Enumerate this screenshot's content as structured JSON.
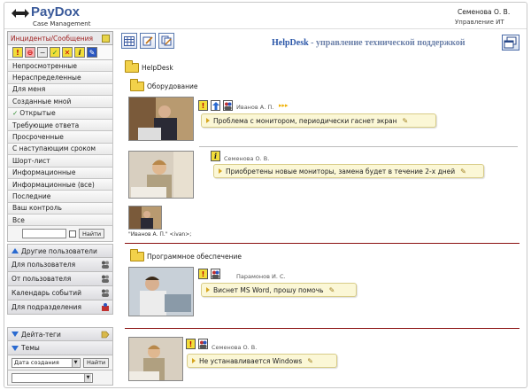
{
  "header": {
    "logo_text": "PayDox",
    "logo_subtitle": "Case Management",
    "user_name": "Семенова О. В.",
    "user_dept": "Управление ИТ"
  },
  "sidebar": {
    "section_title": "Инциденты/Сообщения",
    "menu": [
      {
        "label": "Непросмотренные"
      },
      {
        "label": "Нераспределенные"
      },
      {
        "label": "Для меня"
      },
      {
        "label": "Созданные мной"
      },
      {
        "label": "Открытые",
        "checked": true
      },
      {
        "label": "Требующие ответа"
      },
      {
        "label": "Просроченные"
      },
      {
        "label": "С наступающим сроком"
      },
      {
        "label": "Шорт-лист"
      },
      {
        "label": "Информационные"
      },
      {
        "label": "Информационные (все)"
      },
      {
        "label": "Последние"
      },
      {
        "label": "Ваш контроль"
      },
      {
        "label": "Все"
      }
    ],
    "search_button": "Найти",
    "other_users": "Другие пользователи",
    "links": [
      {
        "label": "Для пользователя"
      },
      {
        "label": "От пользователя"
      },
      {
        "label": "Календарь событий"
      },
      {
        "label": "Для подразделения"
      }
    ],
    "date_tags": "Дейта-теги",
    "topics": "Темы",
    "sort_select": "Дата создания",
    "find_button": "Найти"
  },
  "main": {
    "title_first": "HelpDesk",
    "title_rest": " - управление технической поддержкой",
    "root_folder": "HelpDesk",
    "folders": [
      {
        "name": "Оборудование",
        "items": [
          {
            "author": "Иванов А. П.",
            "text": "Проблема с монитором, периодически гаснет экран"
          },
          {
            "author": "Семенова О. В.",
            "text": "Приобретены новые мониторы, замена будет в течение 2-х дней"
          }
        ],
        "photo_caption": "\"Иванов А. П.\" <ivan>;"
      },
      {
        "name": "Программное обеспечение",
        "items": [
          {
            "author": "Парамонов И. С.",
            "text": "Виснет MS Word, прошу помочь"
          },
          {
            "author": "Семенова О. В.",
            "text": "Не устанавливается Windows"
          }
        ]
      }
    ]
  },
  "colors": {
    "accent": "#3a5a9a",
    "separator": "#8b1010",
    "message_bg": "#fbf7d6",
    "badge_yellow": "#f2de3a"
  }
}
